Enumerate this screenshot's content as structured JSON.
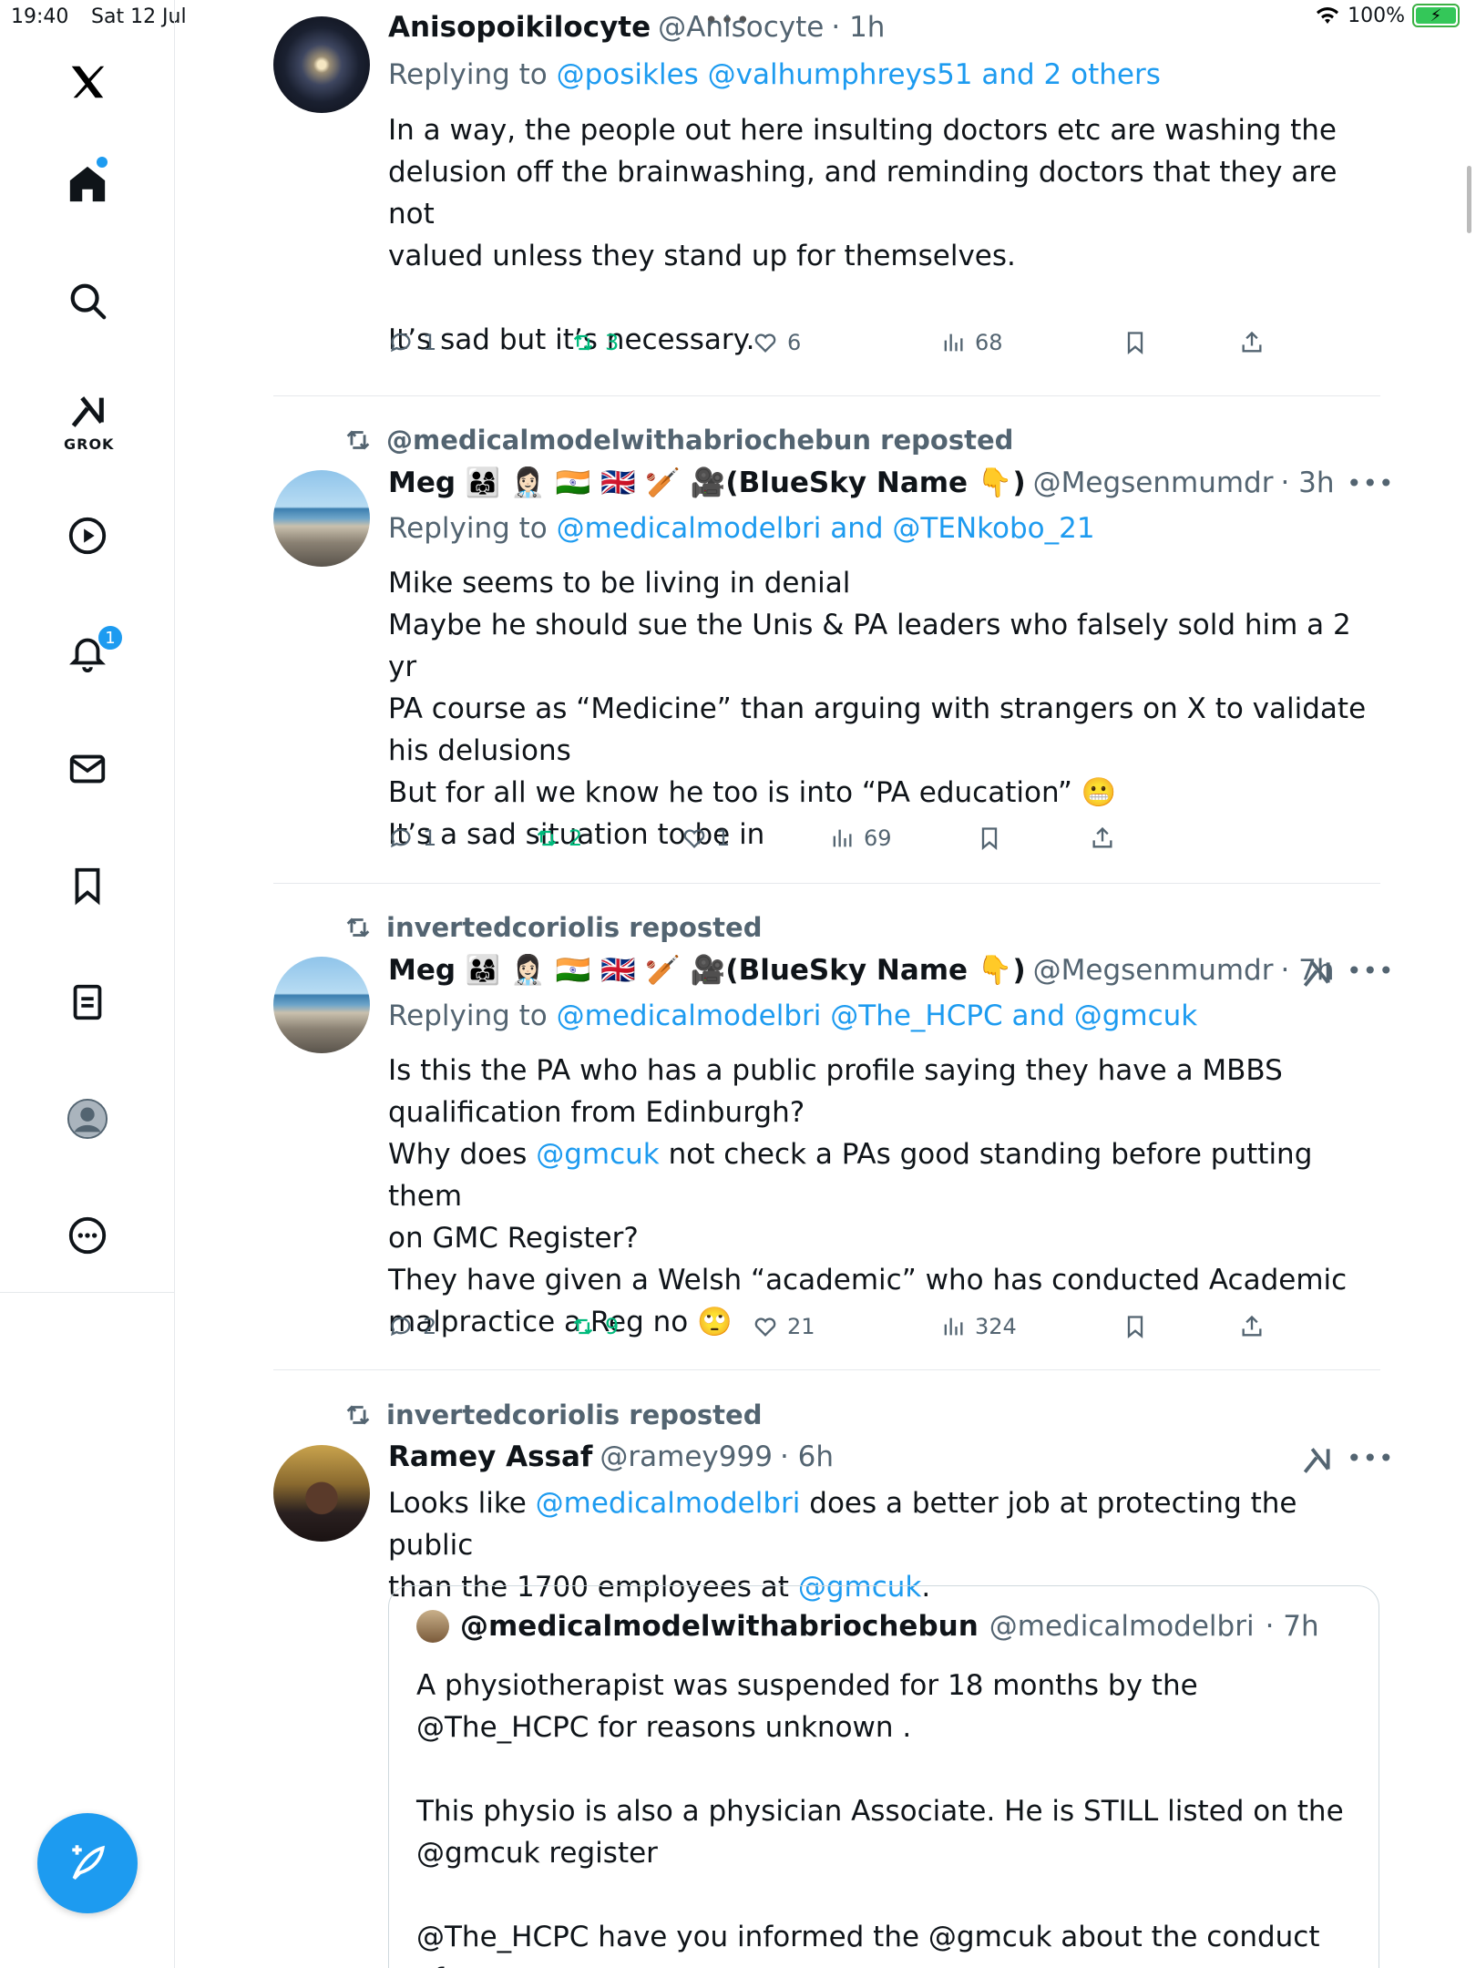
{
  "status_bar": {
    "time": "19:40",
    "date": "Sat 12 Jul",
    "battery": "100%"
  },
  "sidebar": {
    "notification_count": "1",
    "grok_label": "GROK"
  },
  "posts": [
    {
      "name": "Anisopoikilocyte",
      "handle": "@Anisocyte",
      "time": "· 1h",
      "replying_prefix": "Replying to ",
      "replying_to": "@posikles @valhumphreys51 and 2 others",
      "text": "In a way, the people out here insulting doctors etc are washing the\ndelusion off the brainwashing, and reminding doctors that they are not\nvalued unless they stand up for themselves.\n\nIt’s sad but it’s necessary.",
      "replies": "1",
      "reposts": "3",
      "likes": "6",
      "views": "68"
    },
    {
      "reposted_by": "@medicalmodelwithabriochebun reposted",
      "name": "Meg 👨‍👩‍👧 👩🏻‍⚕️ 🇮🇳 🇬🇧 🏏 🎥(BlueSky Name 👇)",
      "handle": "@Megsenmumdr",
      "time": "· 3h",
      "replying_prefix": "Replying to ",
      "replying_to": "@medicalmodelbri and @TENkobo_21",
      "text": "Mike seems to be living in denial\nMaybe he should sue the Unis & PA leaders who falsely sold him a 2 yr\nPA course as “Medicine” than arguing with strangers on X to validate\nhis delusions\nBut for all we know he too is into “PA education” 😬\nIt’s a sad situation to be in",
      "replies": "1",
      "reposts": "2",
      "likes": "1",
      "views": "69"
    },
    {
      "reposted_by": "invertedcoriolis reposted",
      "name": "Meg 👨‍👩‍👧 👩🏻‍⚕️ 🇮🇳 🇬🇧 🏏 🎥(BlueSky Name 👇)",
      "handle": "@Megsenmumdr",
      "time": "· 7h",
      "replying_prefix": "Replying to ",
      "replying_to": "@medicalmodelbri @The_HCPC and @gmcuk",
      "text_a": "Is this the PA who has a public profile saying they have a MBBS\nqualification from Edinburgh?\nWhy does ",
      "text_link": "@gmcuk",
      "text_b": " not check a PAs good standing before putting them\non GMC Register?\nThey have given a Welsh “academic” who has conducted Academic\nmalpractice a Reg no 🙄",
      "replies": "2",
      "reposts": "9",
      "likes": "21",
      "views": "324"
    },
    {
      "reposted_by": "invertedcoriolis reposted",
      "name": "Ramey Assaf",
      "handle": "@ramey999",
      "time": "· 6h",
      "text_a": "Looks like ",
      "text_link1": "@medicalmodelbri",
      "text_b": " does a better job at protecting the public\nthan the 1700 employees at ",
      "text_link2": "@gmcuk",
      "text_c": ".",
      "quote": {
        "name": "@medicalmodelwithabriochebun",
        "handle": "@medicalmodelbri",
        "time": "· 7h",
        "text": "A physiotherapist was suspended for 18 months by the\n@The_HCPC for reasons unknown .\n\nThis physio is also a physician Associate. He is STILL listed on the\n@gmcuk register\n\n@The_HCPC have you informed the @gmcuk about the conduct of"
      }
    }
  ]
}
